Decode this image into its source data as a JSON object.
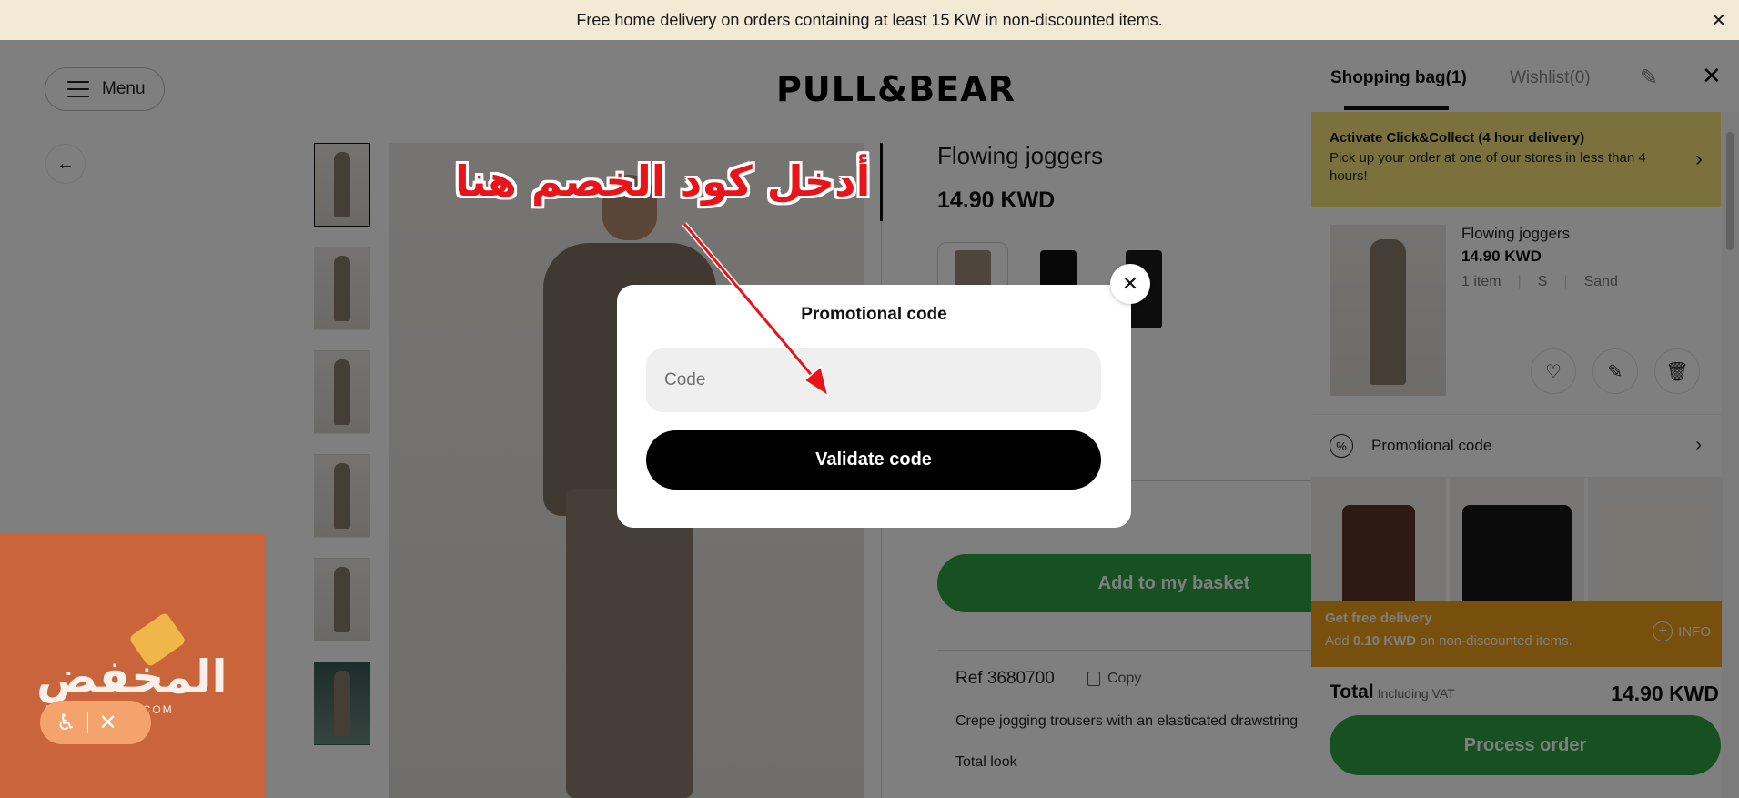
{
  "banner": {
    "text": "Free home delivery on orders containing at least 15 KW in non-discounted items.",
    "close": "✕"
  },
  "header": {
    "menu_label": "Menu",
    "logo": "PULL&BEAR",
    "back": "←"
  },
  "product": {
    "title": "Flowing joggers",
    "price": "14.90 KWD",
    "add_label": "Add to my basket",
    "ref": "Ref 3680700",
    "copy_label": "Copy",
    "description": "Crepe jogging trousers with an elasticated drawstring",
    "total_look": "Total look",
    "swatch_colors": [
      "#9c8a77",
      "#111111",
      "#1a1a1a"
    ]
  },
  "modal": {
    "title": "Promotional code",
    "input_placeholder": "Code",
    "validate_label": "Validate code",
    "close": "✕"
  },
  "annotation": {
    "text": "أدخل كود الخصم هنا"
  },
  "cart": {
    "tab_bag": "Shopping bag(1)",
    "tab_wishlist": "Wishlist(0)",
    "close": "✕",
    "clickcollect_title": "Activate Click&Collect (4 hour delivery)",
    "clickcollect_text": "Pick up your order at one of our stores in less than 4 hours!",
    "item": {
      "name": "Flowing joggers",
      "price": "14.90 KWD",
      "qty": "1 item",
      "size": "S",
      "color": "Sand"
    },
    "promo_label": "Promotional code",
    "free_delivery_title": "Get free delivery",
    "free_delivery_prefix": "Add",
    "free_delivery_amount": "0.10 KWD",
    "free_delivery_suffix": "on non-discounted items.",
    "info_label": "INFO",
    "total_label": "Total",
    "total_vat": "Including VAT",
    "total_price": "14.90 KWD",
    "process_label": "Process order"
  },
  "watermark": {
    "text": "المخفض",
    "subtext": "ALMOKHFA-ID.COM"
  },
  "colors": {
    "accent_green": "#2ea043",
    "promo_yellow": "#f7e37a",
    "free_delivery_orange": "#f0a01a",
    "annotation_red": "#e8141a"
  }
}
